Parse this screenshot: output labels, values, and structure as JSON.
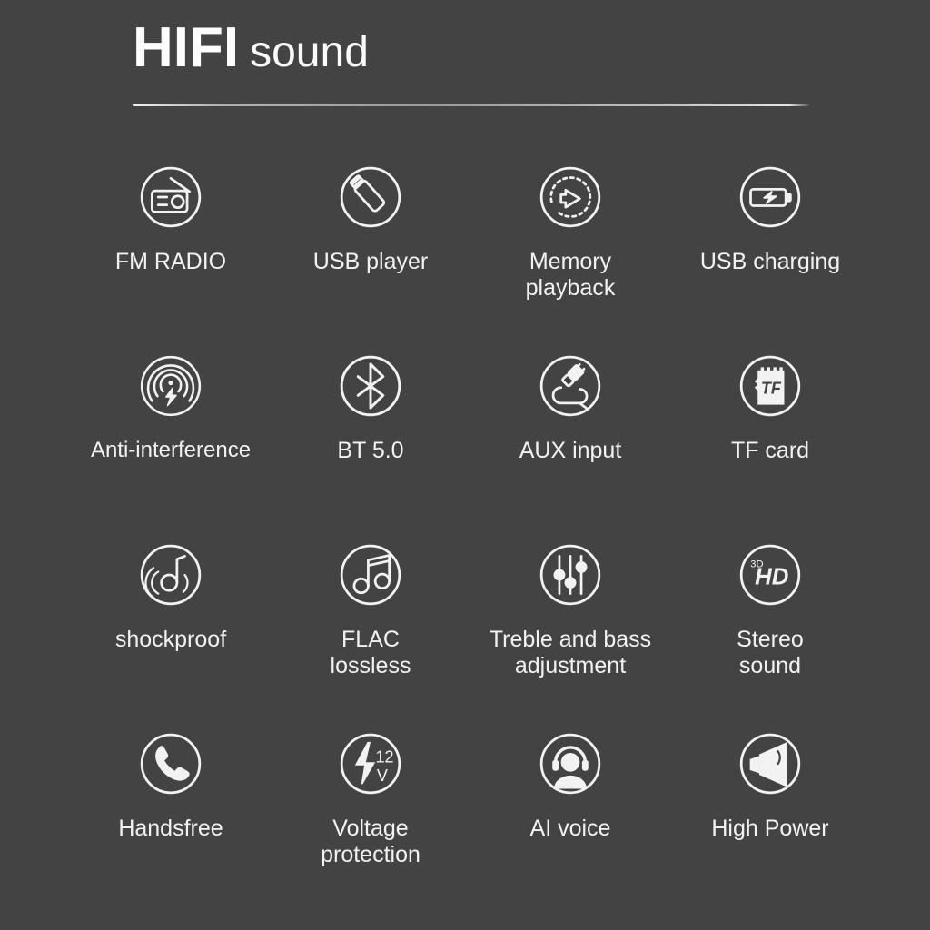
{
  "header": {
    "title_strong": "HIFI",
    "title_light": "sound"
  },
  "colors": {
    "background": "#434343",
    "foreground": "#f2f2f2",
    "title": "#fdfdfd",
    "divider": "#dcdcdc"
  },
  "features": [
    {
      "icon": "fm-radio-icon",
      "label": "FM RADIO"
    },
    {
      "icon": "usb-flash-drive-icon",
      "label": "USB player"
    },
    {
      "icon": "memory-playback-icon",
      "label": "Memory\nplayback"
    },
    {
      "icon": "battery-charging-icon",
      "label": "USB charging"
    },
    {
      "icon": "anti-interference-icon",
      "label": "Anti-interference"
    },
    {
      "icon": "bluetooth-icon",
      "label": "BT 5.0"
    },
    {
      "icon": "aux-plug-icon",
      "label": "AUX input"
    },
    {
      "icon": "tf-card-icon",
      "label": "TF card"
    },
    {
      "icon": "shockproof-note-icon",
      "label": "shockproof"
    },
    {
      "icon": "music-notes-icon",
      "label": "FLAC\nlossless"
    },
    {
      "icon": "equalizer-sliders-icon",
      "label": "Treble and bass\nadjustment"
    },
    {
      "icon": "hd-3d-icon",
      "label": "Stereo\nsound"
    },
    {
      "icon": "phone-handset-icon",
      "label": "Handsfree"
    },
    {
      "icon": "voltage-bolt-icon",
      "label": "Voltage\nprotection"
    },
    {
      "icon": "headset-person-icon",
      "label": "AI voice"
    },
    {
      "icon": "speaker-horn-icon",
      "label": "High Power"
    }
  ],
  "icon_glyph_text": {
    "tf_card": "TF",
    "hd_badge_small": "3D",
    "hd_badge_main": "HD",
    "voltage_number": "12",
    "voltage_unit": "V"
  }
}
